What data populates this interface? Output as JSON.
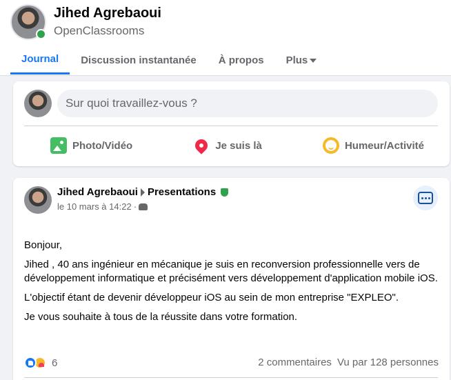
{
  "profile": {
    "name": "Jihed Agrebaoui",
    "subtitle": "OpenClassrooms"
  },
  "tabs": [
    {
      "label": "Journal",
      "active": true
    },
    {
      "label": "Discussion instantanée"
    },
    {
      "label": "À propos"
    },
    {
      "label": "Plus"
    }
  ],
  "composer": {
    "placeholder": "Sur quoi travaillez-vous ?",
    "actions": [
      {
        "label": "Photo/Vidéo",
        "icon": "photo-video-icon",
        "color": "#45bd62"
      },
      {
        "label": "Je suis là",
        "icon": "location-pin-icon",
        "color": "#f02849"
      },
      {
        "label": "Humeur/Activité",
        "icon": "smiley-icon",
        "color": "#f7b928"
      }
    ]
  },
  "post": {
    "author": "Jihed Agrebaoui",
    "group": "Presentations",
    "date": "le 10 mars à 14:22",
    "separator": "·",
    "paragraphs": [
      "Bonjour,",
      "Jihed , 40 ans ingénieur en mécanique je suis en reconversion professionnelle vers de développement informatique et précisément vers développement d'application mobile iOS.",
      "L'objectif étant de devenir développeur iOS au sein de mon entreprise \"EXPLEO\".",
      "Je vous souhaite à tous de la réussite dans votre formation."
    ],
    "reaction_count": "6",
    "comments": "2 commentaires",
    "views": "Vu par 128 personnes"
  },
  "colors": {
    "accent": "#1877f2",
    "online": "#31a24c",
    "background": "#f0f2f5"
  }
}
